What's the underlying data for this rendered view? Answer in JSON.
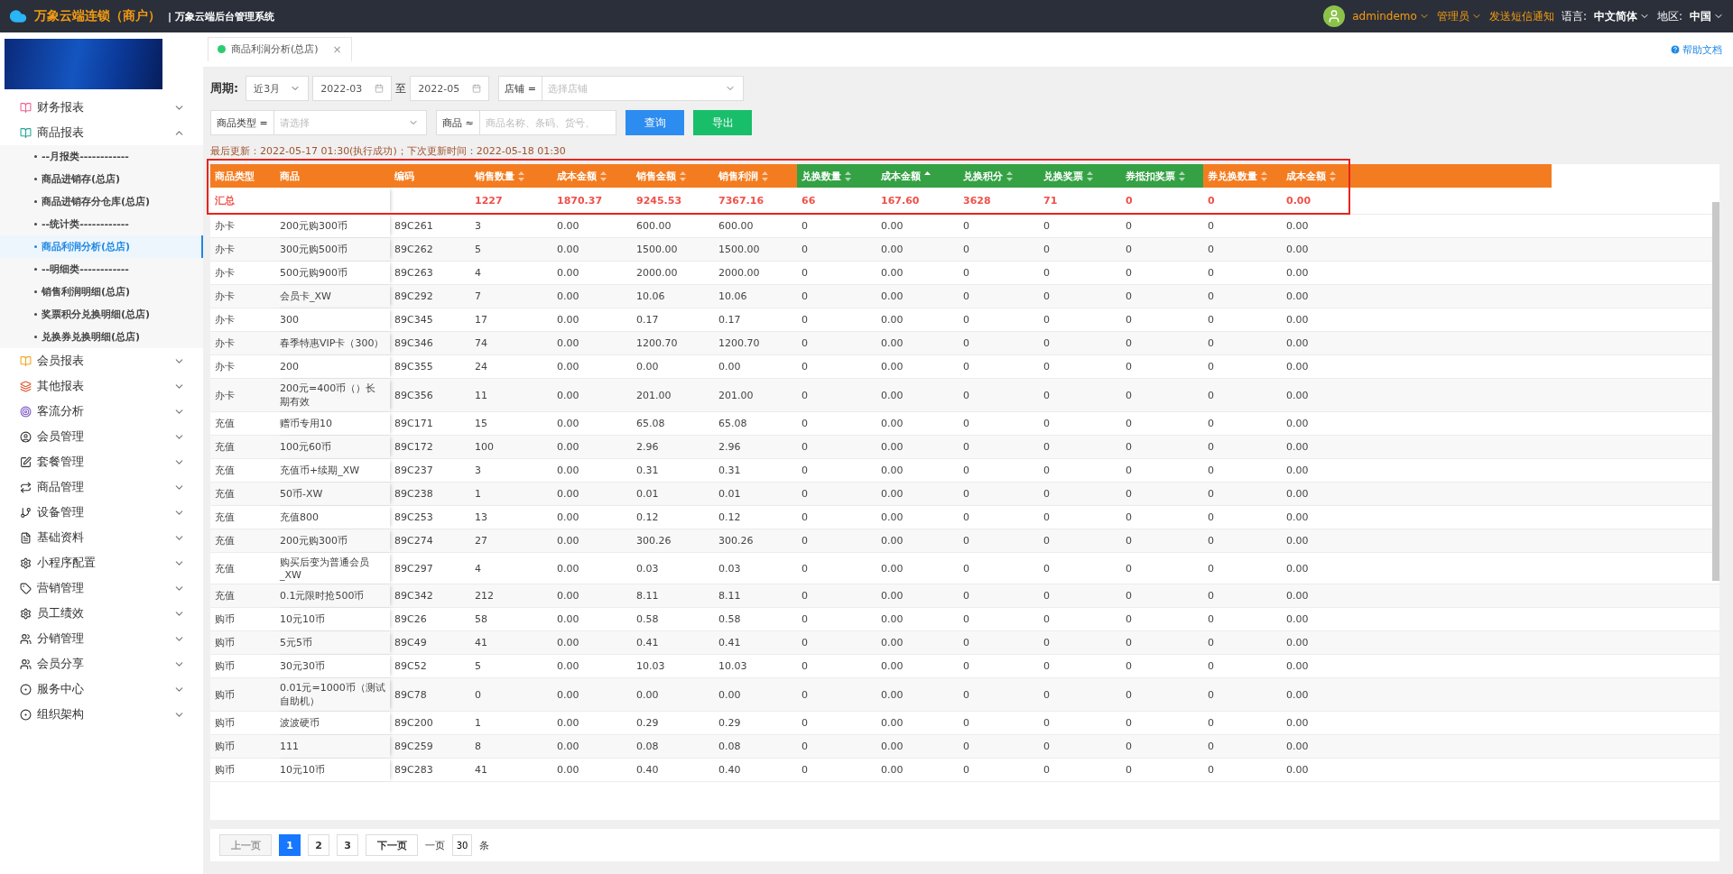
{
  "topbar": {
    "brand": "万象云端连锁（商户）",
    "system": "| 万象云端后台管理系统",
    "user": "admindemo",
    "role": "管理员",
    "sms": "发送短信通知",
    "language_label": "语言:",
    "language": "中文简体",
    "region_label": "地区:",
    "region": "中国"
  },
  "sidebar": {
    "items": [
      {
        "label": "财务报表",
        "expanded": false
      },
      {
        "label": "商品报表",
        "expanded": true,
        "children": [
          {
            "label": "--月报类------------",
            "selected": false
          },
          {
            "label": "商品进销存(总店)",
            "selected": false
          },
          {
            "label": "商品进销存分仓库(总店)",
            "selected": false
          },
          {
            "label": "--统计类------------",
            "selected": false
          },
          {
            "label": "商品利润分析(总店)",
            "selected": true
          },
          {
            "label": "--明细类------------",
            "selected": false
          },
          {
            "label": "销售利润明细(总店)",
            "selected": false
          },
          {
            "label": "奖票积分兑换明细(总店)",
            "selected": false
          },
          {
            "label": "兑换券兑换明细(总店)",
            "selected": false
          }
        ]
      },
      {
        "label": "会员报表",
        "expanded": false
      },
      {
        "label": "其他报表",
        "expanded": false
      },
      {
        "label": "客流分析",
        "expanded": false
      },
      {
        "label": "会员管理",
        "expanded": false
      },
      {
        "label": "套餐管理",
        "expanded": false
      },
      {
        "label": "商品管理",
        "expanded": false
      },
      {
        "label": "设备管理",
        "expanded": false
      },
      {
        "label": "基础资料",
        "expanded": false
      },
      {
        "label": "小程序配置",
        "expanded": false
      },
      {
        "label": "营销管理",
        "expanded": false
      },
      {
        "label": "员工绩效",
        "expanded": false
      },
      {
        "label": "分销管理",
        "expanded": false
      },
      {
        "label": "会员分享",
        "expanded": false
      },
      {
        "label": "服务中心",
        "expanded": false
      },
      {
        "label": "组织架构",
        "expanded": false
      }
    ]
  },
  "tabs": [
    {
      "label": "商品利润分析(总店)",
      "close": "×",
      "selected": true
    }
  ],
  "help": "帮助文档",
  "filters": {
    "period_label": "周期:",
    "period": "近3月",
    "from": "2022-03",
    "to_label": "至",
    "to": "2022-05",
    "store_label": "店铺 =",
    "store_placeholder": "选择店铺",
    "type_label": "商品类型 =",
    "type_placeholder": "请选择",
    "product_label": "商品 ≈",
    "product_placeholder": "商品名称、条码、货号、",
    "query": "查询",
    "export": "导出"
  },
  "update_info": "最后更新：2022-05-17 01:30(执行成功)；下次更新时间：2022-05-18 01:30",
  "table": {
    "columns": [
      {
        "label": "商品类型",
        "sortable": false,
        "color": "#f47c20"
      },
      {
        "label": "商品",
        "sortable": false,
        "color": "#f47c20"
      },
      {
        "label": "编码",
        "sortable": false,
        "color": "#f47c20"
      },
      {
        "label": "销售数量",
        "sortable": true,
        "sorted": false,
        "color": "#f47c20"
      },
      {
        "label": "成本金额",
        "sortable": true,
        "sorted": false,
        "color": "#f47c20"
      },
      {
        "label": "销售金额",
        "sortable": true,
        "sorted": false,
        "color": "#f47c20"
      },
      {
        "label": "销售利润",
        "sortable": true,
        "sorted": false,
        "color": "#f47c20"
      },
      {
        "label": "兑换数量",
        "sortable": true,
        "sorted": false,
        "color": "#35a145"
      },
      {
        "label": "成本金额",
        "sortable": true,
        "sorted": true,
        "color": "#35a145"
      },
      {
        "label": "兑换积分",
        "sortable": true,
        "sorted": false,
        "color": "#35a145"
      },
      {
        "label": "兑换奖票",
        "sortable": true,
        "sorted": false,
        "color": "#35a145"
      },
      {
        "label": "券抵扣奖票",
        "sortable": true,
        "sorted": false,
        "color": "#35a145"
      },
      {
        "label": "券兑换数量",
        "sortable": true,
        "sorted": false,
        "color": "#f47c20"
      },
      {
        "label": "成本金额",
        "sortable": true,
        "sorted": false,
        "color": "#f47c20"
      }
    ],
    "summary": {
      "label": "汇总",
      "values": [
        "1227",
        "1870.37",
        "9245.53",
        "7367.16",
        "66",
        "167.60",
        "3628",
        "71",
        "0",
        "0",
        "0.00"
      ]
    },
    "rows": [
      [
        "办卡",
        "200元购300币",
        "89C261",
        "3",
        "0.00",
        "600.00",
        "600.00",
        "0",
        "0.00",
        "0",
        "0",
        "0",
        "0",
        "0.00"
      ],
      [
        "办卡",
        "300元购500币",
        "89C262",
        "5",
        "0.00",
        "1500.00",
        "1500.00",
        "0",
        "0.00",
        "0",
        "0",
        "0",
        "0",
        "0.00"
      ],
      [
        "办卡",
        "500元购900币",
        "89C263",
        "4",
        "0.00",
        "2000.00",
        "2000.00",
        "0",
        "0.00",
        "0",
        "0",
        "0",
        "0",
        "0.00"
      ],
      [
        "办卡",
        "会员卡_XW",
        "89C292",
        "7",
        "0.00",
        "10.06",
        "10.06",
        "0",
        "0.00",
        "0",
        "0",
        "0",
        "0",
        "0.00"
      ],
      [
        "办卡",
        "300",
        "89C345",
        "17",
        "0.00",
        "0.17",
        "0.17",
        "0",
        "0.00",
        "0",
        "0",
        "0",
        "0",
        "0.00"
      ],
      [
        "办卡",
        "春季特惠VIP卡（300）",
        "89C346",
        "74",
        "0.00",
        "1200.70",
        "1200.70",
        "0",
        "0.00",
        "0",
        "0",
        "0",
        "0",
        "0.00"
      ],
      [
        "办卡",
        "200",
        "89C355",
        "24",
        "0.00",
        "0.00",
        "0.00",
        "0",
        "0.00",
        "0",
        "0",
        "0",
        "0",
        "0.00"
      ],
      [
        "办卡",
        "200元=400币（）长期有效",
        "89C356",
        "11",
        "0.00",
        "201.00",
        "201.00",
        "0",
        "0.00",
        "0",
        "0",
        "0",
        "0",
        "0.00"
      ],
      [
        "充值",
        "赠币专用10",
        "89C171",
        "15",
        "0.00",
        "65.08",
        "65.08",
        "0",
        "0.00",
        "0",
        "0",
        "0",
        "0",
        "0.00"
      ],
      [
        "充值",
        "100元60币",
        "89C172",
        "100",
        "0.00",
        "2.96",
        "2.96",
        "0",
        "0.00",
        "0",
        "0",
        "0",
        "0",
        "0.00"
      ],
      [
        "充值",
        "充值币+续期_XW",
        "89C237",
        "3",
        "0.00",
        "0.31",
        "0.31",
        "0",
        "0.00",
        "0",
        "0",
        "0",
        "0",
        "0.00"
      ],
      [
        "充值",
        "50币-XW",
        "89C238",
        "1",
        "0.00",
        "0.01",
        "0.01",
        "0",
        "0.00",
        "0",
        "0",
        "0",
        "0",
        "0.00"
      ],
      [
        "充值",
        "充值800",
        "89C253",
        "13",
        "0.00",
        "0.12",
        "0.12",
        "0",
        "0.00",
        "0",
        "0",
        "0",
        "0",
        "0.00"
      ],
      [
        "充值",
        "200元购300币",
        "89C274",
        "27",
        "0.00",
        "300.26",
        "300.26",
        "0",
        "0.00",
        "0",
        "0",
        "0",
        "0",
        "0.00"
      ],
      [
        "充值",
        "购买后变为普通会员_XW",
        "89C297",
        "4",
        "0.00",
        "0.03",
        "0.03",
        "0",
        "0.00",
        "0",
        "0",
        "0",
        "0",
        "0.00"
      ],
      [
        "充值",
        "0.1元限时抢500币",
        "89C342",
        "212",
        "0.00",
        "8.11",
        "8.11",
        "0",
        "0.00",
        "0",
        "0",
        "0",
        "0",
        "0.00"
      ],
      [
        "购币",
        "10元10币",
        "89C26",
        "58",
        "0.00",
        "0.58",
        "0.58",
        "0",
        "0.00",
        "0",
        "0",
        "0",
        "0",
        "0.00"
      ],
      [
        "购币",
        "5元5币",
        "89C49",
        "41",
        "0.00",
        "0.41",
        "0.41",
        "0",
        "0.00",
        "0",
        "0",
        "0",
        "0",
        "0.00"
      ],
      [
        "购币",
        "30元30币",
        "89C52",
        "5",
        "0.00",
        "10.03",
        "10.03",
        "0",
        "0.00",
        "0",
        "0",
        "0",
        "0",
        "0.00"
      ],
      [
        "购币",
        "0.01元=1000币（测试自助机）",
        "89C78",
        "0",
        "0.00",
        "0.00",
        "0.00",
        "0",
        "0.00",
        "0",
        "0",
        "0",
        "0",
        "0.00"
      ],
      [
        "购币",
        "波波硬币",
        "89C200",
        "1",
        "0.00",
        "0.29",
        "0.29",
        "0",
        "0.00",
        "0",
        "0",
        "0",
        "0",
        "0.00"
      ],
      [
        "购币",
        "111",
        "89C259",
        "8",
        "0.00",
        "0.08",
        "0.08",
        "0",
        "0.00",
        "0",
        "0",
        "0",
        "0",
        "0.00"
      ],
      [
        "购币",
        "10元10币",
        "89C283",
        "41",
        "0.00",
        "0.40",
        "0.40",
        "0",
        "0.00",
        "0",
        "0",
        "0",
        "0",
        "0.00"
      ]
    ]
  },
  "pagination": {
    "prev": "上一页",
    "pages": [
      {
        "label": "1",
        "selected": true
      },
      {
        "label": "2",
        "selected": false
      },
      {
        "label": "3",
        "selected": false
      }
    ],
    "next": "下一页",
    "per_page_label": "一页",
    "per_page": "30",
    "unit": "条"
  }
}
